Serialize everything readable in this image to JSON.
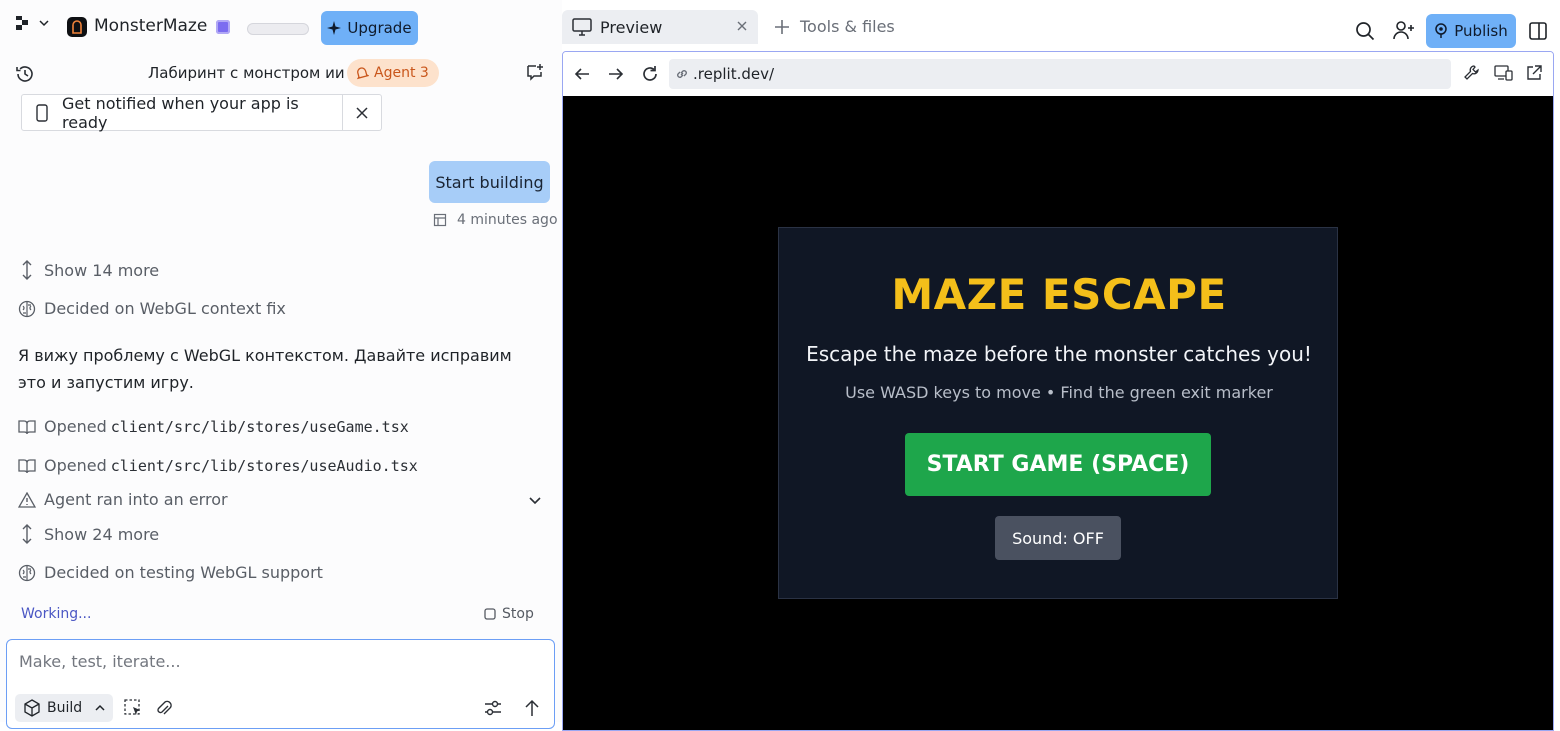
{
  "app": {
    "name": "MonsterMaze",
    "upgrade_label": "Upgrade"
  },
  "chat": {
    "title": "Лабиринт с монстром ии",
    "agent_badge": "Agent 3",
    "notify_text": "Get notified when your app is ready",
    "user_message": "Start building",
    "message_time": "4 minutes ago",
    "log": [
      {
        "kind": "expand",
        "text": "Show 14 more"
      },
      {
        "kind": "thought",
        "text": "Decided on WebGL context fix"
      },
      {
        "kind": "opened",
        "prefix": "Opened",
        "path": "client/src/lib/stores/useGame.tsx"
      },
      {
        "kind": "opened",
        "prefix": "Opened",
        "path": "client/src/lib/stores/useAudio.tsx"
      },
      {
        "kind": "error",
        "text": "Agent ran into an error"
      },
      {
        "kind": "expand",
        "text": "Show 24 more"
      },
      {
        "kind": "thought",
        "text": "Decided on testing WebGL support"
      }
    ],
    "agent_text": "Я вижу проблему с WebGL контекстом. Давайте исправим это и запустим игру.",
    "working_label": "Working...",
    "stop_label": "Stop",
    "input_placeholder": "Make, test, iterate...",
    "build_label": "Build"
  },
  "tabs": {
    "preview_label": "Preview",
    "tools_label": "Tools & files",
    "publish_label": "Publish"
  },
  "browser": {
    "url": ".replit.dev/"
  },
  "game": {
    "title": "MAZE ESCAPE",
    "subtitle": "Escape the maze before the monster catches you!",
    "hint": "Use WASD keys to move • Find the green exit marker",
    "start_label": "START GAME (SPACE)",
    "sound_label": "Sound: OFF"
  },
  "colors": {
    "accent_blue": "#6fb0f7",
    "agent_badge_bg": "#fde2cc",
    "game_title": "#f4bf1a",
    "start_green": "#1ea64b"
  }
}
